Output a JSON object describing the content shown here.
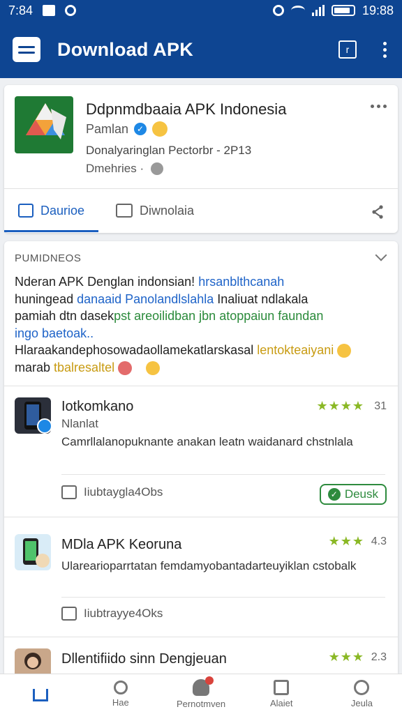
{
  "status_bar": {
    "time": "7:84",
    "clock": "19:88"
  },
  "app_bar": {
    "title": "Download APK",
    "square_icon_label": "r"
  },
  "app_card": {
    "name": "Ddpnmdbaaia APK Indonesia",
    "developer": "Pamlan",
    "updated": "Donalyaringlan Pectorbr - 2P13",
    "category": "Dmehries ·",
    "like_label": "Daurioe",
    "download_label": "Diwnolaia"
  },
  "description": {
    "header": "PUMIDNEOS",
    "line1_a": "Nderan APK Denglan indonsian! ",
    "line1_b": "hrsanblthcanah",
    "line2_a": "huningead ",
    "line2_b": "danaaid Panolandlslahla",
    "line2_c": " Inaliuat ndlakala",
    "line3_a": "pamiah dtn dasek",
    "line3_b": "pst areoilidban jbn atoppaiun faundan",
    "line4": "ingo baetoak..",
    "line5_a": "Hlaraakandephosowadaollamekatlarskasal ",
    "line5_b": "lentokteaiyani",
    "line6_a": "marab ",
    "line6_b": "tbalresaltel"
  },
  "reviews": [
    {
      "name": "Iotkomkano",
      "sub": "Nlanlat",
      "text": "Camrllalanopuknante anakan leatn waidanard chstnlala",
      "stars": "★★★★",
      "rating": "31",
      "likes": "Iiubtaygla4Obs",
      "button": "Deusk"
    },
    {
      "name": "MDla APK Keoruna",
      "text": "Ularearioparrtatan femdamyobantadarteuyiklan cstobalk",
      "stars": "★★★",
      "rating": "4.3",
      "likes": "Iiubtrayye4Oks"
    },
    {
      "name": "Dllentifiido sinn Dengjeuan",
      "stars": "★★★",
      "rating": "2.3"
    }
  ],
  "bottom_nav": [
    {
      "label": ""
    },
    {
      "label": "Hae"
    },
    {
      "label": "Pernotmven"
    },
    {
      "label": "Alaiet"
    },
    {
      "label": "Jeula"
    }
  ],
  "colors": {
    "primary": "#0e4592",
    "accent": "#1b5fbf",
    "star": "#8ab825",
    "green": "#2e8b3e"
  }
}
